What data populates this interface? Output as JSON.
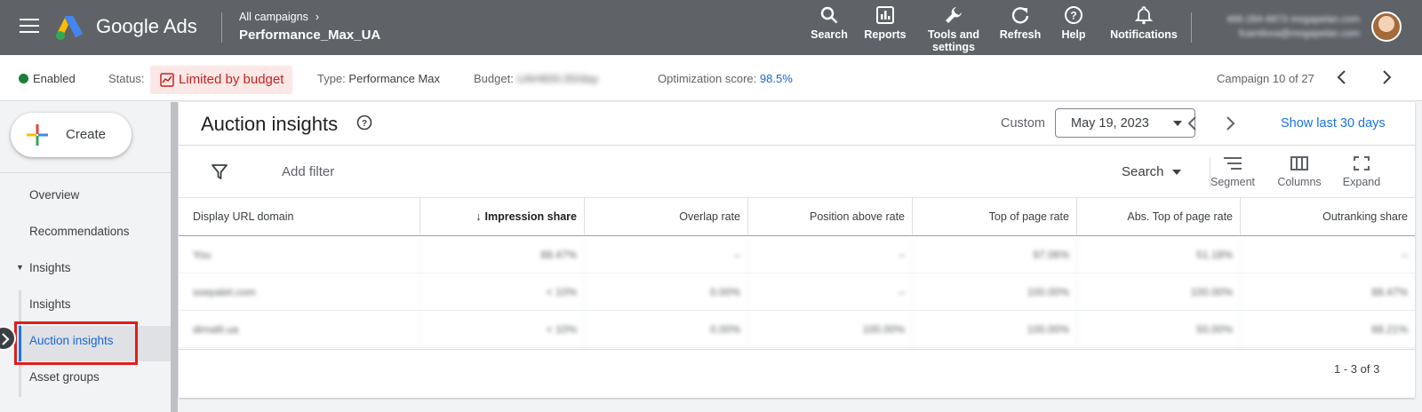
{
  "topbar": {
    "brand": "Google Ads",
    "breadcrumb": "All campaigns",
    "campaign_name": "Performance_Max_UA",
    "tools": [
      {
        "label": "Search",
        "icon": "search-icon"
      },
      {
        "label": "Reports",
        "icon": "reports-icon"
      },
      {
        "label": "Tools and",
        "label2": "settings",
        "icon": "wrench-icon"
      },
      {
        "label": "Refresh",
        "icon": "refresh-icon"
      },
      {
        "label": "Help",
        "icon": "help-icon"
      },
      {
        "label": "Notifications",
        "icon": "bell-icon"
      }
    ],
    "account_line1": "466-284-6873 mogapelan.com",
    "account_line2": "fcamilova@mogapelan.com"
  },
  "status_bar": {
    "state": "Enabled",
    "status_label": "Status:",
    "status_value": "Limited by budget",
    "type_label": "Type:",
    "type_value": "Performance Max",
    "budget_label": "Budget:",
    "budget_value": "UAH600.00/day",
    "opt_label": "Optimization score:",
    "opt_value": "98.5%",
    "campaign_counter": "Campaign 10 of 27"
  },
  "sidebar": {
    "create_label": "Create",
    "items": [
      {
        "label": "Overview"
      },
      {
        "label": "Recommendations"
      },
      {
        "label": "Insights"
      },
      {
        "label": "Insights"
      },
      {
        "label": "Auction insights"
      },
      {
        "label": "Asset groups"
      }
    ]
  },
  "main": {
    "title": "Auction insights",
    "date_mode": "Custom",
    "date_value": "May 19, 2023",
    "show_last": "Show last 30 days",
    "add_filter": "Add filter",
    "search_label": "Search",
    "toolbar": {
      "segment": "Segment",
      "columns": "Columns",
      "expand": "Expand"
    },
    "table": {
      "headers": [
        "Display URL domain",
        "Impression share",
        "Overlap rate",
        "Position above rate",
        "Top of page rate",
        "Abs. Top of page rate",
        "Outranking share"
      ],
      "rows": [
        [
          "You",
          "88.47%",
          "–",
          "–",
          "97.06%",
          "51.18%",
          "–"
        ],
        [
          "ssepalet.com",
          "< 10%",
          "0.00%",
          "–",
          "100.00%",
          "100.00%",
          "88.47%"
        ],
        [
          "dimalit.ua",
          "< 10%",
          "0.00%",
          "100.00%",
          "100.00%",
          "50.00%",
          "88.21%"
        ]
      ]
    },
    "pager": "1 - 3 of 3"
  },
  "colors": {
    "topbar": "#5f6368",
    "accent": "#1a73e8",
    "enabled": "#188038",
    "limited_bg": "#fce8e6",
    "limited_text": "#c5221f",
    "highlight": "#e21b1b"
  }
}
